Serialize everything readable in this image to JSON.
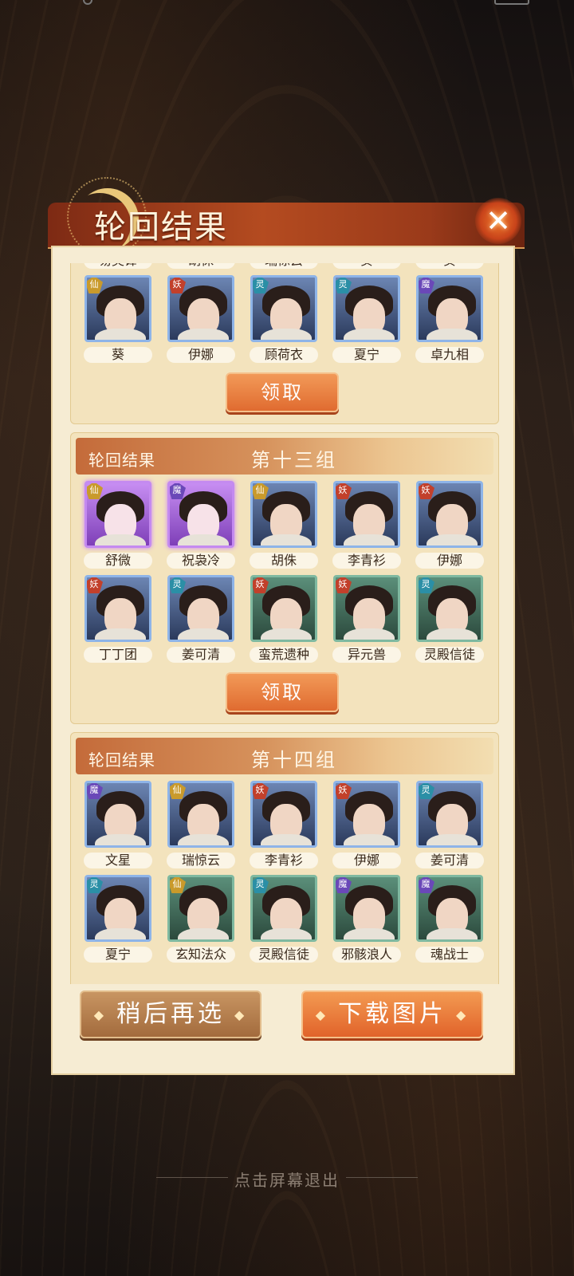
{
  "header": {
    "title": "轮回结果",
    "close_glyph": "✕"
  },
  "prev_group": {
    "top_row_names": [
      "易灵锋",
      "胡侏",
      "瑞惊云",
      "葵",
      "葵"
    ],
    "heroes": [
      {
        "name": "葵",
        "badge": "仙",
        "frame": "blue"
      },
      {
        "name": "伊娜",
        "badge": "妖",
        "frame": "blue"
      },
      {
        "name": "顾荷衣",
        "badge": "灵",
        "frame": "blue"
      },
      {
        "name": "夏宁",
        "badge": "灵",
        "frame": "blue"
      },
      {
        "name": "卓九相",
        "badge": "魔",
        "frame": "blue"
      }
    ],
    "claim_label": "领取"
  },
  "group13": {
    "label": "轮回结果",
    "name": "第十三组",
    "heroes": [
      {
        "name": "舒微",
        "badge": "仙",
        "frame": "purple"
      },
      {
        "name": "祝袅冷",
        "badge": "魔",
        "frame": "purple"
      },
      {
        "name": "胡侏",
        "badge": "仙",
        "frame": "blue"
      },
      {
        "name": "李青衫",
        "badge": "妖",
        "frame": "blue"
      },
      {
        "name": "伊娜",
        "badge": "妖",
        "frame": "blue"
      },
      {
        "name": "丁丁团",
        "badge": "妖",
        "frame": "blue"
      },
      {
        "name": "姜可清",
        "badge": "灵",
        "frame": "blue"
      },
      {
        "name": "蛮荒遗种",
        "badge": "妖",
        "frame": "green"
      },
      {
        "name": "异元兽",
        "badge": "妖",
        "frame": "green"
      },
      {
        "name": "灵殿信徒",
        "badge": "灵",
        "frame": "green"
      }
    ],
    "claim_label": "领取"
  },
  "group14": {
    "label": "轮回结果",
    "name": "第十四组",
    "heroes": [
      {
        "name": "文星",
        "badge": "魔",
        "frame": "blue"
      },
      {
        "name": "瑞惊云",
        "badge": "仙",
        "frame": "blue"
      },
      {
        "name": "李青衫",
        "badge": "妖",
        "frame": "blue"
      },
      {
        "name": "伊娜",
        "badge": "妖",
        "frame": "blue"
      },
      {
        "name": "姜可清",
        "badge": "灵",
        "frame": "blue"
      },
      {
        "name": "夏宁",
        "badge": "灵",
        "frame": "blue"
      },
      {
        "name": "玄知法众",
        "badge": "仙",
        "frame": "green"
      },
      {
        "name": "灵殿信徒",
        "badge": "灵",
        "frame": "green"
      },
      {
        "name": "邪骸浪人",
        "badge": "魔",
        "frame": "green"
      },
      {
        "name": "魂战士",
        "badge": "魔",
        "frame": "green"
      }
    ]
  },
  "buttons": {
    "later": "稍后再选",
    "download": "下载图片",
    "diamond": "◆"
  },
  "footer": {
    "exit_hint": "点击屏幕退出"
  },
  "colors": {
    "accent": "#e06b30",
    "panel": "#f6ecd3",
    "header": "#b44b20"
  }
}
